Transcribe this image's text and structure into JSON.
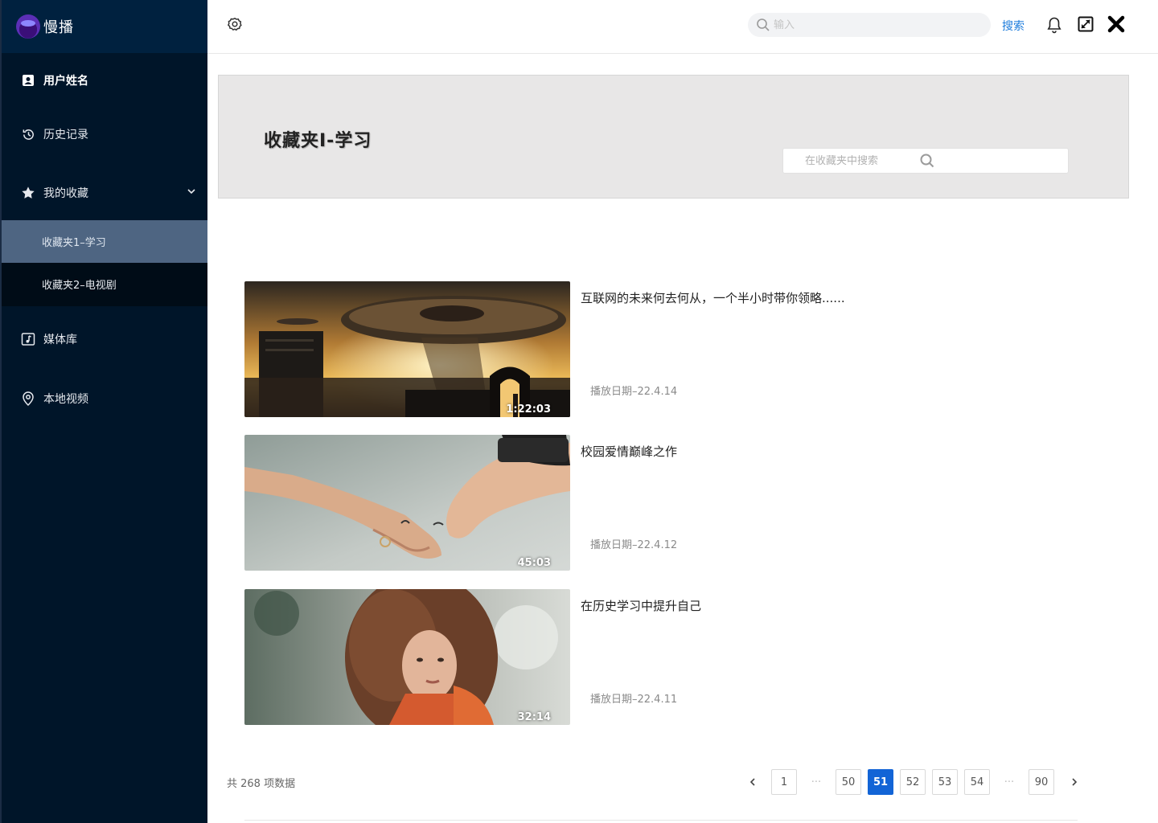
{
  "app": {
    "name": "慢播"
  },
  "sidebar": {
    "user": "用户姓名",
    "history": "历史记录",
    "favorites": "我的收藏",
    "sub_items": [
      "收藏夹1–学习",
      "收藏夹2–电视剧"
    ],
    "library": "媒体库",
    "local": "本地视频"
  },
  "header": {
    "search_placeholder": "输入",
    "search_label": "搜索"
  },
  "banner": {
    "title": "收藏夹I-学习",
    "search_placeholder": "在收藏夹中搜索"
  },
  "videos": [
    {
      "title": "互联网的未来何去何从，一个半小时带你领略......",
      "date": "播放日期–22.4.14",
      "duration": "1:22:03"
    },
    {
      "title": "校园爱情巅峰之作",
      "date": "播放日期–22.4.12",
      "duration": "45:03"
    },
    {
      "title": "在历史学习中提升自己",
      "date": "播放日期–22.4.11",
      "duration": "32:14"
    }
  ],
  "pagination": {
    "total": "共 268 项数据",
    "pages": [
      "1",
      "···",
      "50",
      "51",
      "52",
      "53",
      "54",
      "···",
      "90"
    ],
    "current": "51"
  },
  "colors": {
    "sidebar_bg": "#001529",
    "active_sub": "#4e6582",
    "accent": "#1264d6",
    "link": "#1d7cdc"
  }
}
